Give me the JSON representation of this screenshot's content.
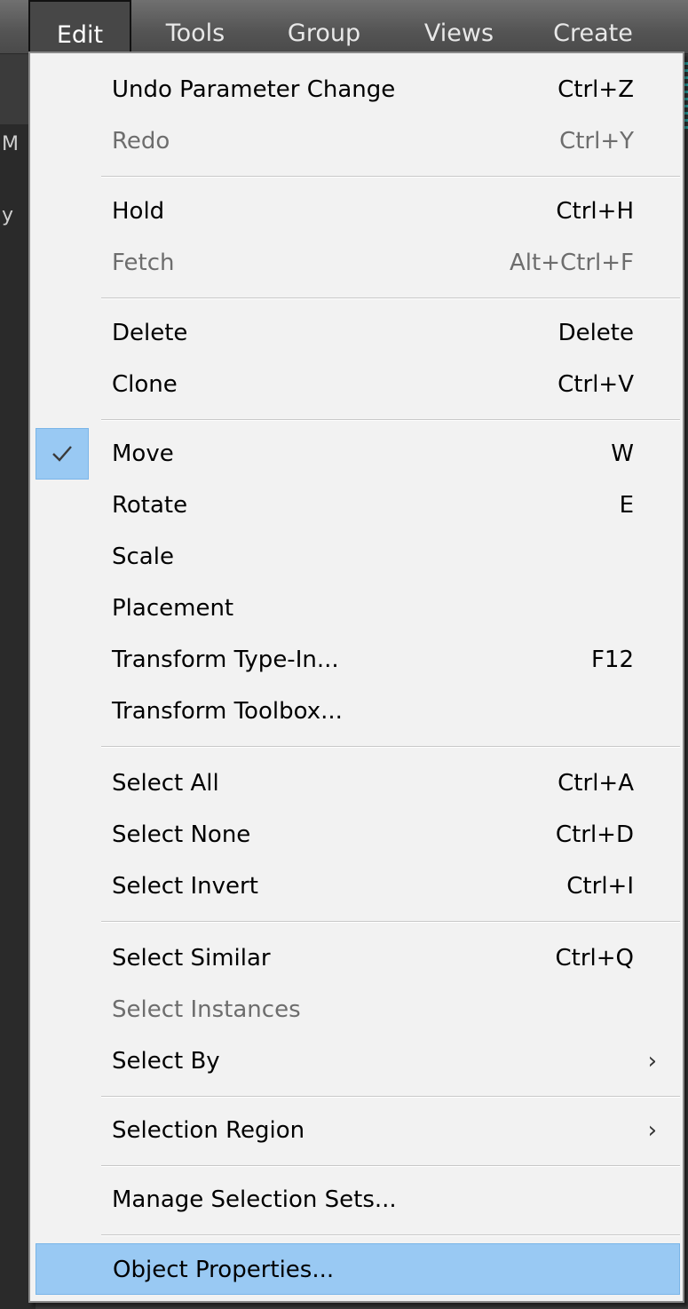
{
  "menubar": {
    "items": [
      {
        "label": "Edit",
        "active": true
      },
      {
        "label": "Tools"
      },
      {
        "label": "Group"
      },
      {
        "label": "Views"
      },
      {
        "label": "Create"
      }
    ]
  },
  "background_fragments": [
    "M",
    "y"
  ],
  "edit_menu": {
    "items": [
      {
        "label": "Undo Parameter Change",
        "shortcut": "Ctrl+Z"
      },
      {
        "label": "Redo",
        "shortcut": "Ctrl+Y",
        "disabled": true
      },
      {
        "label": "Hold",
        "shortcut": "Ctrl+H"
      },
      {
        "label": "Fetch",
        "shortcut": "Alt+Ctrl+F",
        "disabled": true
      },
      {
        "label": "Delete",
        "shortcut": "Delete"
      },
      {
        "label": "Clone",
        "shortcut": "Ctrl+V"
      },
      {
        "label": "Move",
        "shortcut": "W",
        "checked": true
      },
      {
        "label": "Rotate",
        "shortcut": "E"
      },
      {
        "label": "Scale",
        "shortcut": ""
      },
      {
        "label": "Placement",
        "shortcut": ""
      },
      {
        "label": "Transform Type-In...",
        "shortcut": "F12"
      },
      {
        "label": "Transform Toolbox...",
        "shortcut": ""
      },
      {
        "label": "Select All",
        "shortcut": "Ctrl+A"
      },
      {
        "label": "Select None",
        "shortcut": "Ctrl+D"
      },
      {
        "label": "Select Invert",
        "shortcut": "Ctrl+I"
      },
      {
        "label": "Select Similar",
        "shortcut": "Ctrl+Q"
      },
      {
        "label": "Select Instances",
        "shortcut": "",
        "disabled": true
      },
      {
        "label": "Select By",
        "submenu_arrow": "›"
      },
      {
        "label": "Selection Region",
        "submenu_arrow": "›"
      },
      {
        "label": "Manage Selection Sets..."
      },
      {
        "label": "Object Properties...",
        "highlighted": true
      }
    ]
  },
  "colors": {
    "menu_background": "#f2f2f2",
    "highlight": "#99c9f3",
    "disabled_text": "#6d6d6d",
    "menubar": "#545454"
  }
}
